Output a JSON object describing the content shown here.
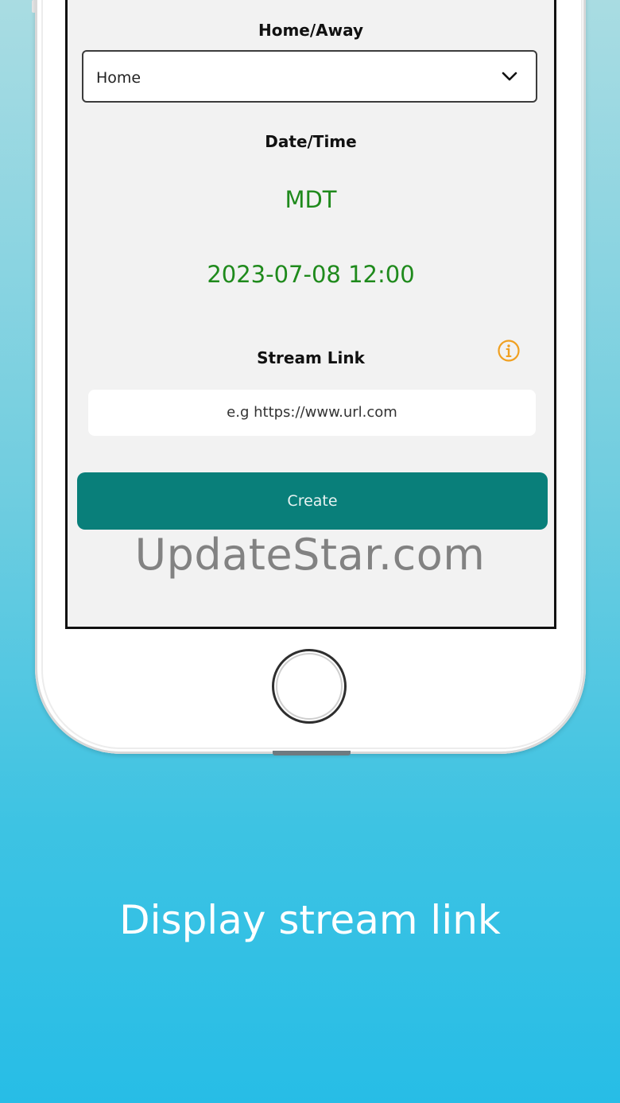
{
  "form": {
    "home_away_label": "Home/Away",
    "home_away_value": "Home",
    "datetime_label": "Date/Time",
    "timezone": "MDT",
    "datetime_value": "2023-07-08 12:00",
    "stream_link_label": "Stream Link",
    "stream_link_placeholder": "e.g https://www.url.com",
    "create_label": "Create"
  },
  "watermark": "UpdateStar.com",
  "caption": "Display stream link",
  "colors": {
    "accent": "#097f7a",
    "datetime_text": "#1f8a1c",
    "info_icon": "#f0a020",
    "background_top": "#a9dce2",
    "background_bottom": "#27bde6"
  },
  "icons": {
    "dropdown": "chevron-down-icon",
    "info": "info-icon",
    "home": "home-button"
  }
}
